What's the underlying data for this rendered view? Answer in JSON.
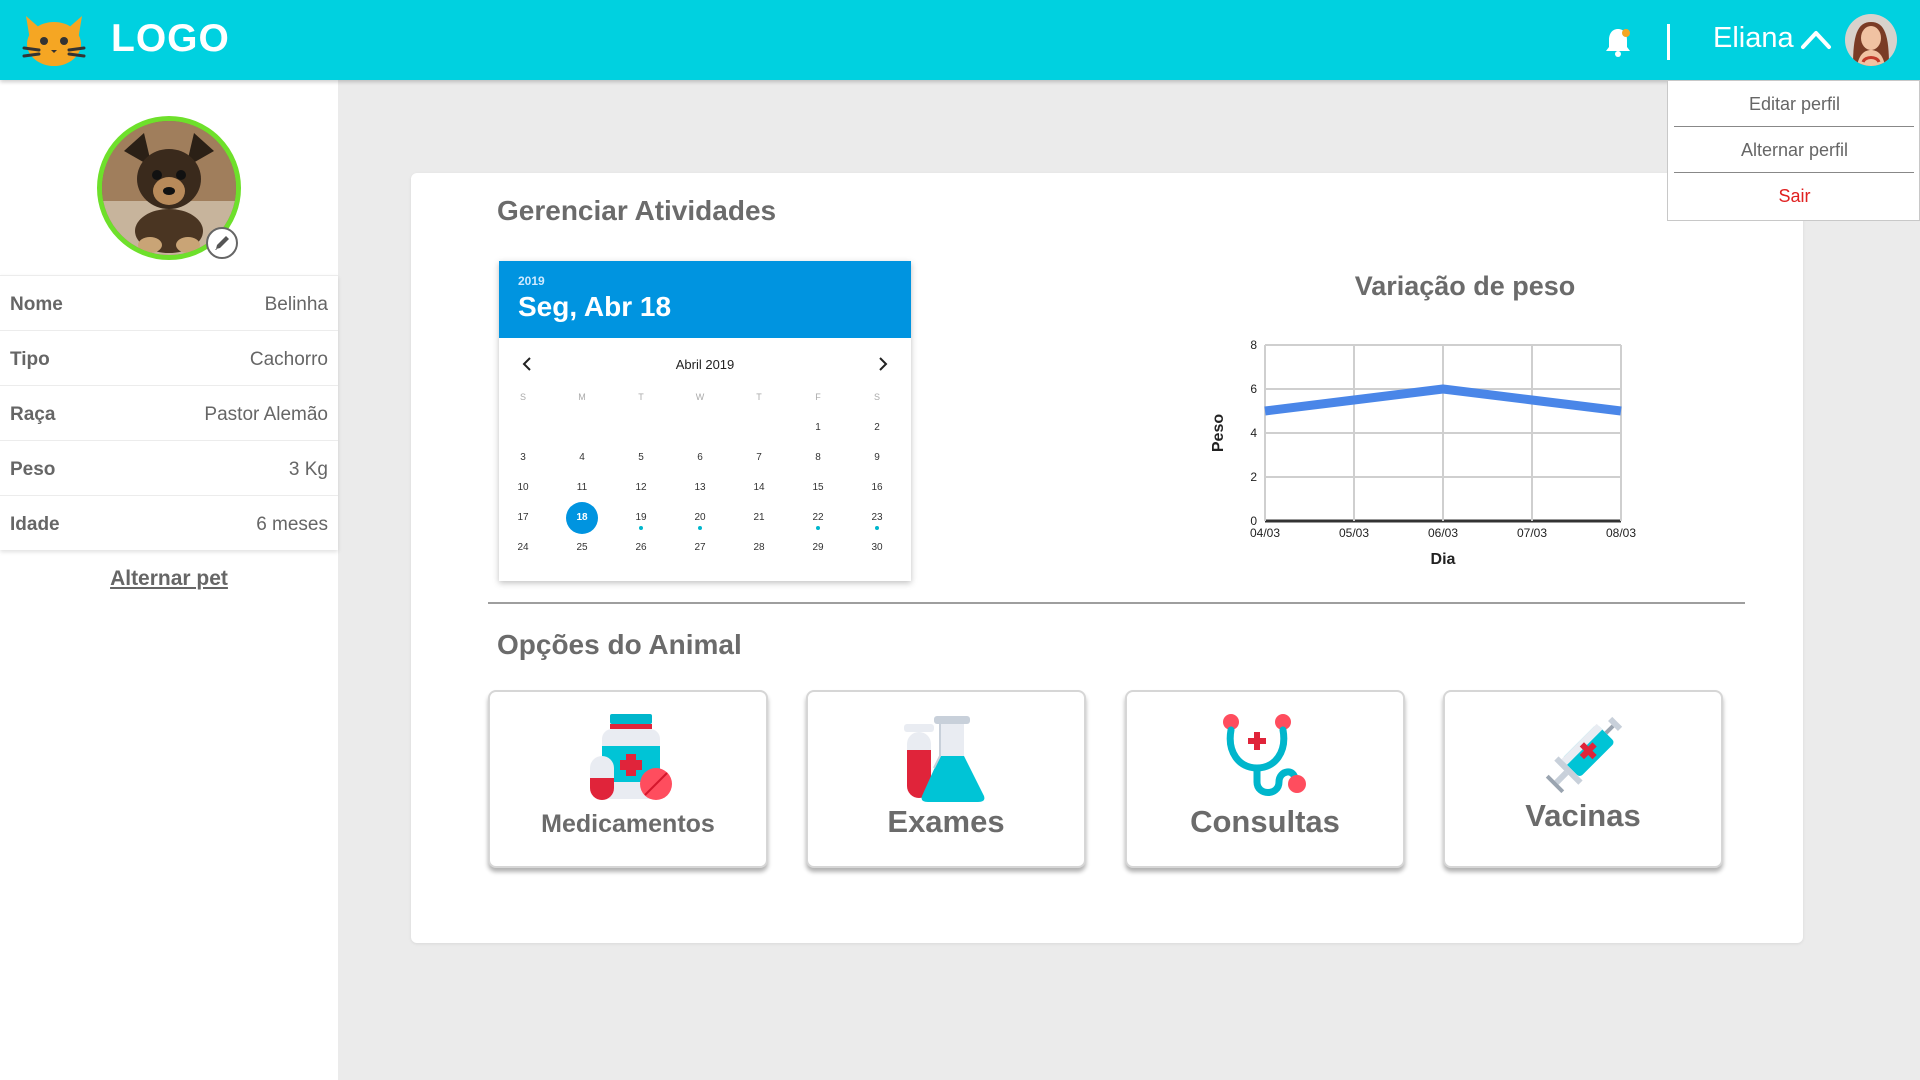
{
  "header": {
    "logo_text": "LOGO",
    "user_name": "Eliana",
    "accent_color": "#00d1e0",
    "icons": [
      "cat-logo-icon",
      "bell-icon",
      "chevron-up-icon"
    ]
  },
  "dropdown": {
    "items": [
      {
        "label": "Editar perfil"
      },
      {
        "label": "Alternar perfil"
      },
      {
        "label": "Sair"
      }
    ]
  },
  "sidebar": {
    "rows": [
      {
        "label": "Nome",
        "value": "Belinha"
      },
      {
        "label": "Tipo",
        "value": "Cachorro"
      },
      {
        "label": "Raça",
        "value": "Pastor Alemão"
      },
      {
        "label": "Peso",
        "value": "3 Kg"
      },
      {
        "label": "Idade",
        "value": "6 meses"
      }
    ],
    "switch_pet": "Alternar pet"
  },
  "main": {
    "activities_title": "Gerenciar Atividades",
    "options_title": "Opções do Animal"
  },
  "calendar": {
    "year": "2019",
    "selected_label": "Seg, Abr 18",
    "month_label": "Abril 2019",
    "weekdays": [
      "S",
      "M",
      "T",
      "W",
      "T",
      "F",
      "S"
    ],
    "weeks": [
      [
        "",
        "",
        "",
        "",
        "",
        "1",
        "2"
      ],
      [
        "3",
        "4",
        "5",
        "6",
        "7",
        "8",
        "9"
      ],
      [
        "10",
        "11",
        "12",
        "13",
        "14",
        "15",
        "16"
      ],
      [
        "17",
        "18",
        "19",
        "20",
        "21",
        "22",
        "23"
      ],
      [
        "24",
        "25",
        "26",
        "27",
        "28",
        "29",
        "30"
      ]
    ],
    "selected_day": "18",
    "marked_days": [
      "19",
      "20",
      "22",
      "23"
    ],
    "selected_color": "#0094e0"
  },
  "chart_data": {
    "type": "line",
    "title": "Variação de peso",
    "xlabel": "Dia",
    "ylabel": "Peso",
    "categories": [
      "04/03",
      "05/03",
      "06/03",
      "07/03",
      "08/03"
    ],
    "series": [
      {
        "values": [
          5,
          5.5,
          6,
          5.5,
          5
        ],
        "color": "#4a86e8"
      }
    ],
    "ylim": [
      0,
      8
    ],
    "yticks": [
      "0",
      "2",
      "4",
      "6",
      "8"
    ],
    "grid": true
  },
  "options": [
    {
      "label": "Medicamentos",
      "icon": "medicine-bottle-icon"
    },
    {
      "label": "Exames",
      "icon": "test-tubes-icon"
    },
    {
      "label": "Consultas",
      "icon": "stethoscope-icon"
    },
    {
      "label": "Vacinas",
      "icon": "syringe-icon"
    }
  ]
}
